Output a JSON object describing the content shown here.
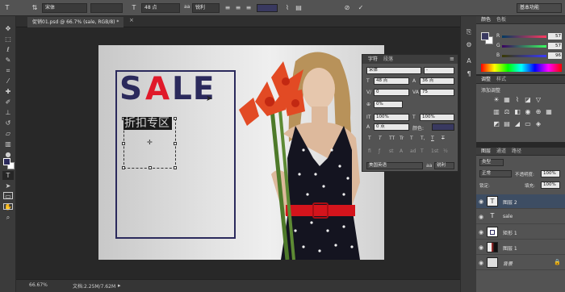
{
  "options_bar": {
    "font_family": "宋体",
    "font_size": "48 点",
    "antialias": "锐利",
    "workspace": "基本功能"
  },
  "document_tab": {
    "title": "促销01.psd @ 66.7% (sale, RGB/8) *"
  },
  "canvas": {
    "sale_s": "S",
    "sale_a": "A",
    "sale_le": "LE",
    "cjk_text": "折扣专区",
    "colors": {
      "navy": "#2b2a5c",
      "red": "#e0192a",
      "dress_red": "#d4141c"
    }
  },
  "status": {
    "zoom": "66.67%",
    "doc_size": "文档:2.25M/7.62M"
  },
  "character_panel": {
    "tab_char": "字符",
    "tab_para": "段落",
    "font_family": "宋体",
    "font_style": "-",
    "size": "48 点",
    "leading": "36 点",
    "kerning": "0",
    "tracking": "75",
    "tsume": "0%",
    "vscale": "100%",
    "hscale": "100%",
    "baseline": "0 点",
    "color_label": "颜色:",
    "language": "美国英语",
    "aa": "锐利",
    "style_buttons": [
      "T",
      "T",
      "TT",
      "Tr",
      "T",
      "T,",
      "T",
      "T"
    ]
  },
  "color_panel": {
    "tab_color": "颜色",
    "tab_swatch": "色板",
    "r_label": "R",
    "r_value": "57",
    "g_label": "G",
    "g_value": "57",
    "b_label": "B",
    "b_value": "96"
  },
  "adjustments_panel": {
    "tab_adj": "调整",
    "tab_styles": "样式",
    "hint": "添加调整"
  },
  "layers_panel": {
    "tab_layers": "图层",
    "tab_channels": "通道",
    "tab_paths": "路径",
    "filter": "类型",
    "blend_mode": "正常",
    "opacity_label": "不透明度:",
    "opacity": "100%",
    "lock_label": "锁定:",
    "fill_label": "填充:",
    "fill": "100%",
    "layers": [
      {
        "name": "图层 2",
        "type": "text"
      },
      {
        "name": "sale",
        "type": "text"
      },
      {
        "name": "矩形 1",
        "type": "shape"
      },
      {
        "name": "图层 1",
        "type": "image"
      },
      {
        "name": "背景",
        "type": "background"
      }
    ]
  }
}
